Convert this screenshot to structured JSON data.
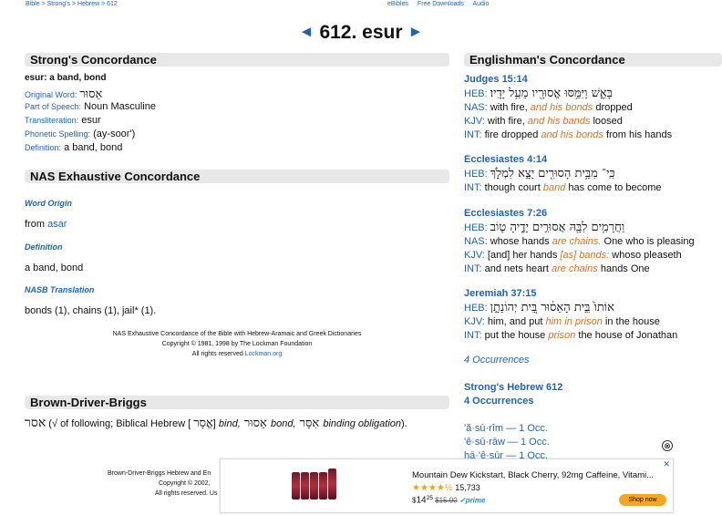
{
  "breadcrumb": {
    "bible": "Bible",
    "sep1": " > ",
    "strongs": "Strong's",
    "sep2": " > ",
    "hebrew": "Hebrew",
    "sep3": " > ",
    "num": "612"
  },
  "toplinks": {
    "ebibles": "eBibles",
    "free": "Free Downloads",
    "audio": "Audio"
  },
  "heading": {
    "prev": "◄",
    "title": "612. esur",
    "next": "►"
  },
  "strongs": {
    "title": "Strong's Concordance",
    "word_def": "esur: a band, bond",
    "orig_lbl": "Original Word:",
    "orig_val": "אֵסוּר",
    "pos_lbl": "Part of Speech:",
    "pos_val": "Noun Masculine",
    "tr_lbl": "Transliteration:",
    "tr_val": "esur",
    "ph_lbl": "Phonetic Spelling:",
    "ph_val": "(ay-soor')",
    "def_lbl": "Definition:",
    "def_val": "a band, bond"
  },
  "nas": {
    "title": "NAS Exhaustive Concordance",
    "wo_lbl": "Word Origin",
    "from": "from ",
    "asar": "asar",
    "def_lbl": "Definition",
    "def_val": "a band, bond",
    "tr_lbl": "NASB Translation",
    "tr_val": "bonds (1), chains (1), jail* (1).",
    "c1": "NAS Exhaustive Concordance of the Bible with Hebrew-Aramaic and Greek Dictionaries",
    "c2": "Copyright © 1981, 1998 by The Lockman Foundation",
    "c3": "All rights reserved ",
    "c3link": "Lockman.org"
  },
  "bdb": {
    "title": "Brown-Driver-Briggs",
    "word": "אסר",
    "t1": " (√ of following; Biblical Hebrew [ ",
    "h1": "אֱסָר",
    "t2": "] ",
    "b1": "bind,",
    "h2": " אֵסוּר ",
    "b2": "bond,",
    "h3": " אִסָּר ",
    "b3": "binding obligation",
    "t3": ").",
    "f1": "Brown-Driver-Briggs Hebrew and En",
    "f2": "Copyright © 2002,",
    "f3": "All rights reserved. Us"
  },
  "englishman": {
    "title": "Englishman's Concordance",
    "entries": [
      {
        "ref": "Judges 15:14",
        "heb": "בָּאֵ֑שׁ וַיִּמַּ֥סּוּ אֱסוּרָ֖יו מֵעַ֥ל יָדָֽיו׃",
        "nas_a": "with fire, ",
        "nas_h": "and his bonds",
        "nas_b": " dropped",
        "kjv_a": "with fire, ",
        "kjv_h": "and his bands",
        "kjv_b": " loosed",
        "int_a": "fire dropped ",
        "int_h": "and his bonds",
        "int_b": " from his hands"
      },
      {
        "ref": "Ecclesiastes 4:14",
        "heb": "כִּֽי־ מִבֵּ֥ית הָסוּרִ֖ים יָצָ֣א לִמְלֹ֑ךְ",
        "int_a": "though court ",
        "int_h": "band",
        "int_b": " has come to become"
      },
      {
        "ref": "Ecclesiastes 7:26",
        "heb": "וַחֲרָמִ֥ים לִבָּ֖הּ אֲסוּרִ֣ים יָדֶ֑יהָ ט֤וֹב",
        "nas_a": "whose hands ",
        "nas_h": "are chains.",
        "nas_b": " One who is pleasing",
        "kjv_a": "[and] her hands ",
        "kjv_h": "[as] bands:",
        "kjv_b": " whoso pleaseth",
        "int_a": "and nets heart ",
        "int_h": "are chains",
        "int_b": " hands One"
      },
      {
        "ref": "Jeremiah 37:15",
        "heb": "אוֹתוֹ֙ בֵּ֣ית הָאֵס֔וּר בֵּ֚ית יְהוֹנָתָ֣ן",
        "kjv_a": "him, and put ",
        "kjv_h": "him in prison",
        "kjv_b": " in the house",
        "int_a": "put the house ",
        "int_h": "prison",
        "int_b": " the house of Jonathan"
      }
    ],
    "occ": "4 Occurrences",
    "strongs_heb": "Strong's Hebrew 612",
    "occ2": "4 Occurrences",
    "translits": [
      "'ă·sū·rîm — 1 Occ.",
      "'ê·sū·rāw — 1 Occ.",
      "hā·'ê·sūr — 1 Occ."
    ]
  },
  "labels": {
    "heb": "HEB:",
    "nas": "NAS:",
    "kjv": "KJV:",
    "int": "INT:"
  },
  "ad": {
    "title": "Mountain Dew Kickstart, Black Cherry, 92mg Caffeine, Vitami...",
    "stars": "★★★★½",
    "reviews": "15,733",
    "price_sym": "$",
    "price_whole": "14",
    "price_frac": "25",
    "old": "$15.00",
    "prime": "✓prime",
    "shop": "Shop now",
    "close": "⊗",
    "x": "✕"
  }
}
